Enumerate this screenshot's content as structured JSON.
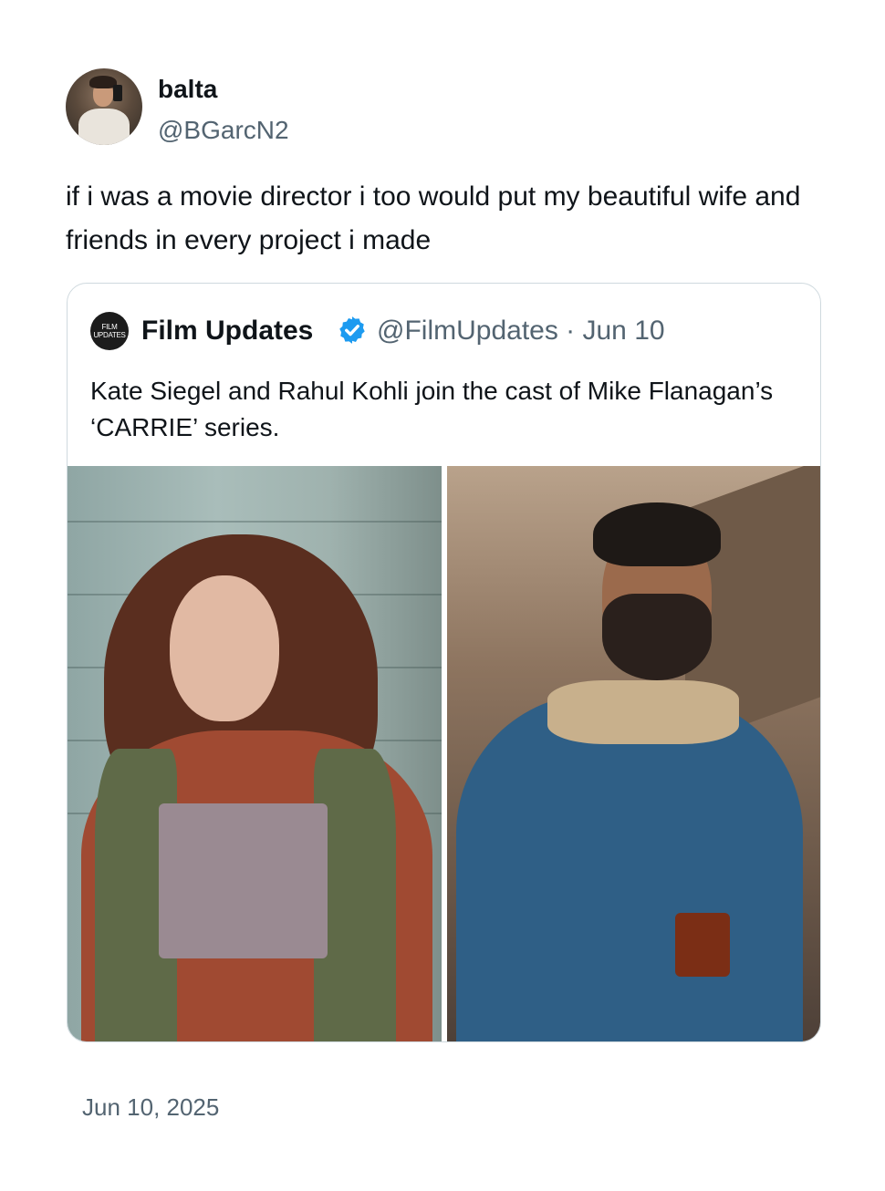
{
  "tweet": {
    "author": {
      "name": "balta",
      "handle": "@BGarcN2"
    },
    "text": "if i was a movie director i too would put my beautiful wife and friends in every project i made",
    "date": "Jun 10, 2025"
  },
  "quoted_tweet": {
    "author": {
      "name": "Film Updates",
      "handle": "@FilmUpdates",
      "verified": true,
      "avatar_text": "FILM UPDATES"
    },
    "meta": "@FilmUpdates · Jun 10",
    "text": "Kate Siegel and Rahul Kohli join the cast of Mike Flanagan’s ‘CARRIE’ series.",
    "images": [
      "photo-woman-red-turtleneck",
      "photo-man-denim-jacket"
    ]
  },
  "colors": {
    "text": "#0f1419",
    "secondary": "#536471",
    "border": "#cfd9de",
    "verified": "#1d9bf0"
  }
}
